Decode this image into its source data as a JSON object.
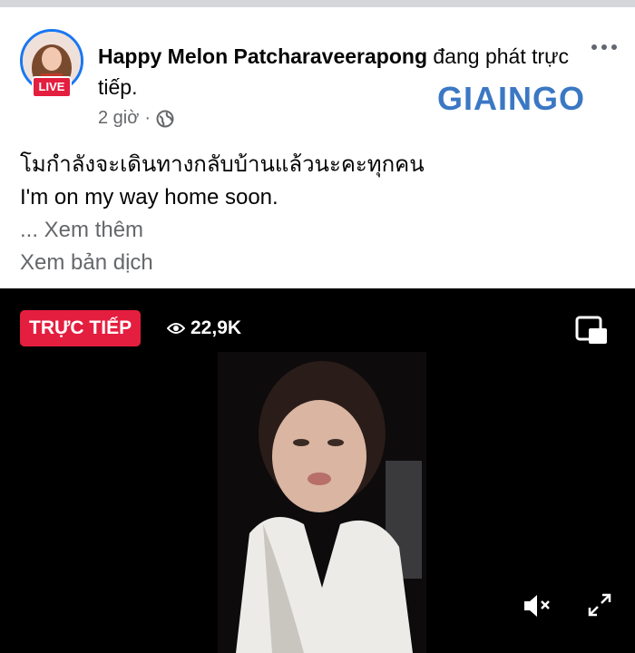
{
  "post": {
    "author_name": "Happy Melon Patcharaveerapong",
    "status_text": " đang phát trực tiếp.",
    "time": "2 giờ",
    "separator": "·",
    "live_badge": "LIVE",
    "body_lines": [
      "โมกำลังจะเดินทางกลับบ้านแล้วนะคะทุกคน",
      "I'm on my way home soon."
    ],
    "see_more": "... Xem thêm",
    "see_translation": "Xem bản dịch",
    "watermark": "GIAINGO"
  },
  "video": {
    "live_label": "TRỰC TIẾP",
    "viewer_count": "22,9K"
  },
  "icons": {
    "more": "more-horizontal-icon",
    "privacy": "globe-icon",
    "viewers": "eye-icon",
    "pip": "picture-in-picture-icon",
    "mute": "speaker-muted-icon",
    "expand": "expand-icon"
  },
  "colors": {
    "live_red": "#e41e3f",
    "facebook_blue": "#1877f2",
    "secondary_text": "#65676b"
  }
}
